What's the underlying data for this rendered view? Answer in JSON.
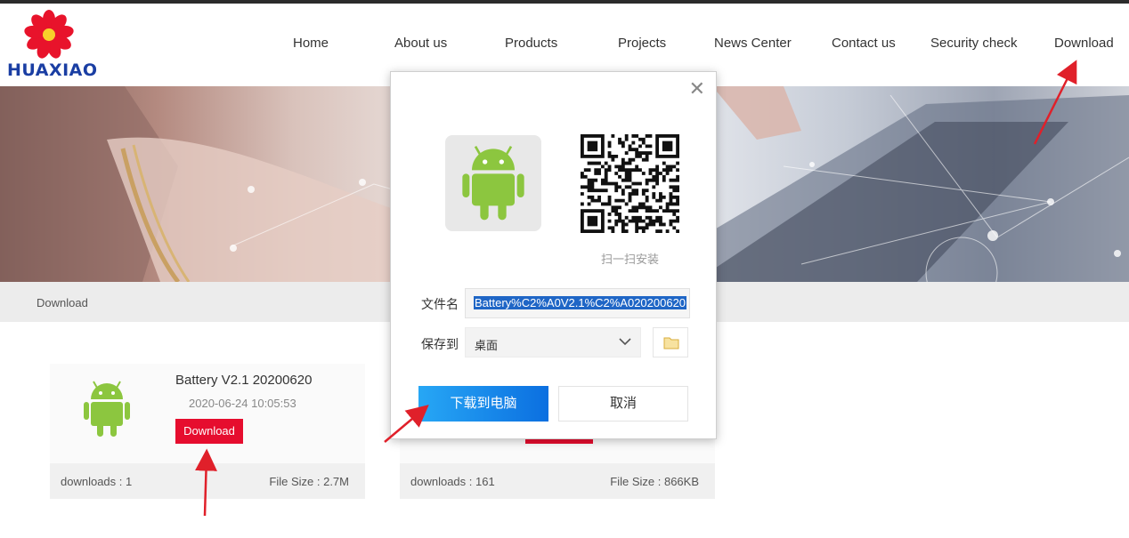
{
  "brand": {
    "name": "HUAXIAO"
  },
  "nav": [
    {
      "label": "Home"
    },
    {
      "label": "About us"
    },
    {
      "label": "Products"
    },
    {
      "label": "Projects"
    },
    {
      "label": "News Center"
    },
    {
      "label": "Contact us"
    },
    {
      "label": "Security check"
    },
    {
      "label": "Download"
    }
  ],
  "breadcrumb": "Download",
  "cards": [
    {
      "title": "Battery V2.1 20200620",
      "date": "2020-06-24 10:05:53",
      "button_label": "Download",
      "downloads": "downloads : 1",
      "file_size": "File Size : 2.7M"
    },
    {
      "downloads": "downloads : 161",
      "file_size": "File Size : 866KB"
    }
  ],
  "dialog": {
    "close_symbol": "✕",
    "qr_caption": "扫一扫安装",
    "filename_label": "文件名",
    "filename_value": "Battery%C2%A0V2.1%C2%A020200620",
    "save_to_label": "保存到",
    "save_to_value": "桌面",
    "download_button": "下载到电脑",
    "cancel_button": "取消"
  },
  "colors": {
    "accent_red": "#e60d2e",
    "brand_blue": "#1a3ea3",
    "android_green": "#8cc63f",
    "primary_blue": "#0b6fe0",
    "annotation_arrow": "#e0202a"
  },
  "icons": [
    "flower-logo-icon",
    "android-icon",
    "qr-code-icon",
    "chevron-down-icon",
    "folder-icon",
    "close-icon",
    "annotation-arrow-icon"
  ]
}
